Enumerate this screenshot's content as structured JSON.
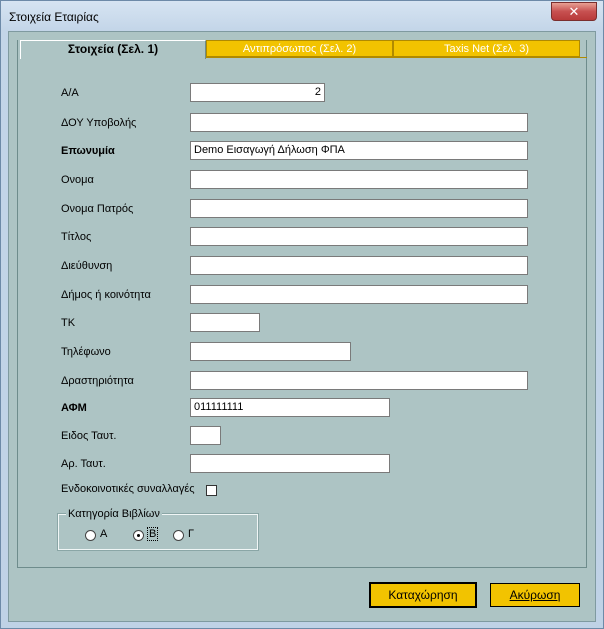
{
  "window": {
    "title": "Στοιχεία Εταιρίας",
    "close_glyph": "✕"
  },
  "tabs": [
    {
      "label": "Στοιχεία (Σελ. 1)"
    },
    {
      "label": "Αντιπρόσωπος (Σελ. 2)"
    },
    {
      "label": "Taxis Net (Σελ. 3)"
    }
  ],
  "form": {
    "aa": {
      "label": "Α/Α",
      "value": "2"
    },
    "doy": {
      "label": "ΔΟΥ Υποβολής",
      "value": ""
    },
    "eponymia": {
      "label": "Επωνυμία",
      "value": "Demo Εισαγωγή Δήλωση ΦΠΑ"
    },
    "onoma": {
      "label": "Ονομα",
      "value": ""
    },
    "onoma_patros": {
      "label": "Ονομα Πατρός",
      "value": ""
    },
    "titlos": {
      "label": "Τίτλος",
      "value": ""
    },
    "dieuthinsi": {
      "label": "Διεύθυνση",
      "value": ""
    },
    "dimos": {
      "label": "Δήμος ή κοινότητα",
      "value": ""
    },
    "tk": {
      "label": "ΤΚ",
      "value": ""
    },
    "tilefono": {
      "label": "Τηλέφωνο",
      "value": ""
    },
    "drastiriotita": {
      "label": "Δραστηριότητα",
      "value": ""
    },
    "afm": {
      "label": "ΑΦΜ",
      "value": "011111111"
    },
    "eidos_taut": {
      "label": "Ειδος Ταυτ.",
      "value": ""
    },
    "ar_taut": {
      "label": "Αρ. Ταυτ.",
      "value": ""
    },
    "endokoinotikes": {
      "label": "Ενδοκοινοτικές συναλλαγές",
      "checked": false
    }
  },
  "books_category": {
    "label": "Κατηγορία Βιβλίων",
    "options": [
      "Α",
      "Β",
      "Γ"
    ],
    "selected": "Β"
  },
  "buttons": {
    "save": "Καταχώρηση",
    "cancel": "Ακύρωση"
  }
}
